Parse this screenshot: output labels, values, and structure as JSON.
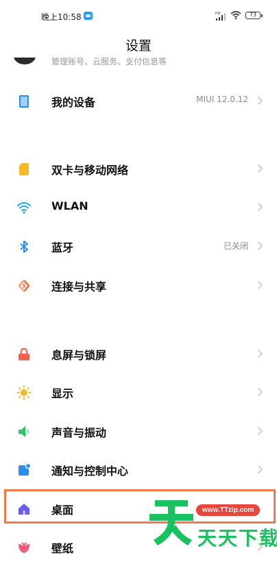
{
  "status_bar": {
    "time": "晚上10:58",
    "battery": "73"
  },
  "header": {
    "title": "设置"
  },
  "account": {
    "subtitle": "管理账号、云服务、支付信息等"
  },
  "items": [
    {
      "label": "我的设备",
      "value": "MIUI 12.0.12",
      "icon": "phone-icon",
      "color": "#2a8cf5"
    },
    {
      "label": "双卡与移动网络",
      "value": "",
      "icon": "sim-card-icon",
      "color": "#f5b82a"
    },
    {
      "label": "WLAN",
      "value": "",
      "icon": "wifi-icon",
      "color": "#21a6f0"
    },
    {
      "label": "蓝牙",
      "value": "已关闭",
      "icon": "bluetooth-icon",
      "color": "#2a8cf5"
    },
    {
      "label": "连接与共享",
      "value": "",
      "icon": "share-icon",
      "color": "#f26b3c"
    },
    {
      "label": "息屏与锁屏",
      "value": "",
      "icon": "lock-icon",
      "color": "#f2634f"
    },
    {
      "label": "显示",
      "value": "",
      "icon": "sun-icon",
      "color": "#f5b82a"
    },
    {
      "label": "声音与振动",
      "value": "",
      "icon": "speaker-icon",
      "color": "#2ec26a"
    },
    {
      "label": "通知与控制中心",
      "value": "",
      "icon": "notification-icon",
      "color": "#2a8cf5"
    },
    {
      "label": "桌面",
      "value": "",
      "icon": "home-icon",
      "color": "#6a5cf0"
    },
    {
      "label": "壁纸",
      "value": "",
      "icon": "flower-icon",
      "color": "#f05a7a"
    }
  ],
  "watermark": {
    "url": "www.TTzip.com",
    "text": "天天下载"
  }
}
